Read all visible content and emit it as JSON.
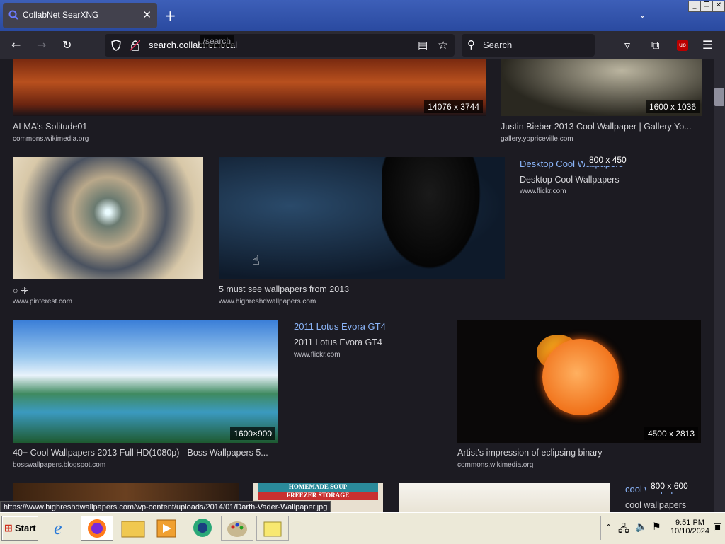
{
  "browser": {
    "tab_title": "CollabNet SearXNG",
    "url_host": "search.collabnet.local",
    "url_path": "/search",
    "search_placeholder": "Search",
    "status_url": "https://www.highreshdwallpapers.com/wp-content/uploads/2014/01/Darth-Vader-Wallpaper.jpg",
    "ublock_label": "uo"
  },
  "results": {
    "r1": {
      "title": "ALMA's Solitude01",
      "source": "commons.wikimedia.org",
      "dims": "14076 x 3744"
    },
    "r2": {
      "title": "Justin Bieber 2013 Cool Wallpaper | Gallery Yo...",
      "source": "gallery.yopriceville.com",
      "dims": "1600 x 1036"
    },
    "r3": {
      "title": "○  ꔰ",
      "source": "www.pinterest.com"
    },
    "r4": {
      "title": "5 must see wallpapers from 2013",
      "source": "www.highreshdwallpapers.com"
    },
    "r5": {
      "link": "Desktop Cool Wallpapers",
      "title": "Desktop Cool Wallpapers",
      "source": "www.flickr.com",
      "dims": "800 x 450"
    },
    "r6": {
      "title": "40+ Cool Wallpapers 2013 Full HD(1080p) - Boss Wallpapers 5...",
      "source": "bosswallpapers.blogspot.com",
      "dims": "1600×900"
    },
    "r7": {
      "link": "2011 Lotus Evora GT4",
      "title": "2011 Lotus Evora GT4",
      "source": "www.flickr.com"
    },
    "r8": {
      "title": "Artist's impression of eclipsing binary",
      "source": "commons.wikimedia.org",
      "dims": "4500 x 2813"
    },
    "r9": {
      "link": "cool wallpapers",
      "title": "cool wallpapers",
      "dims": "800 x 600"
    },
    "r10": {
      "line1": "HOMEMADE SOUP",
      "line2": "FREEZER STORAGE"
    }
  },
  "taskbar": {
    "start_label": "Start",
    "time": "9:51 PM",
    "date": "10/10/2024"
  }
}
